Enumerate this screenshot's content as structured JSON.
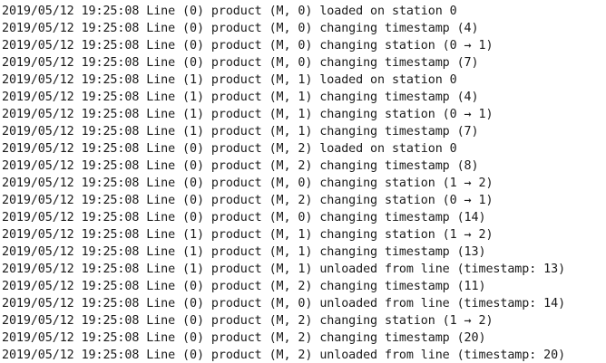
{
  "log": {
    "lines": [
      "2019/05/12 19:25:08 Line (0) product (M, 0) loaded on station 0",
      "2019/05/12 19:25:08 Line (0) product (M, 0) changing timestamp (4)",
      "2019/05/12 19:25:08 Line (0) product (M, 0) changing station (0 → 1)",
      "2019/05/12 19:25:08 Line (0) product (M, 0) changing timestamp (7)",
      "2019/05/12 19:25:08 Line (1) product (M, 1) loaded on station 0",
      "2019/05/12 19:25:08 Line (1) product (M, 1) changing timestamp (4)",
      "2019/05/12 19:25:08 Line (1) product (M, 1) changing station (0 → 1)",
      "2019/05/12 19:25:08 Line (1) product (M, 1) changing timestamp (7)",
      "2019/05/12 19:25:08 Line (0) product (M, 2) loaded on station 0",
      "2019/05/12 19:25:08 Line (0) product (M, 2) changing timestamp (8)",
      "2019/05/12 19:25:08 Line (0) product (M, 0) changing station (1 → 2)",
      "2019/05/12 19:25:08 Line (0) product (M, 2) changing station (0 → 1)",
      "2019/05/12 19:25:08 Line (0) product (M, 0) changing timestamp (14)",
      "2019/05/12 19:25:08 Line (1) product (M, 1) changing station (1 → 2)",
      "2019/05/12 19:25:08 Line (1) product (M, 1) changing timestamp (13)",
      "2019/05/12 19:25:08 Line (1) product (M, 1) unloaded from line (timestamp: 13)",
      "2019/05/12 19:25:08 Line (0) product (M, 2) changing timestamp (11)",
      "2019/05/12 19:25:08 Line (0) product (M, 0) unloaded from line (timestamp: 14)",
      "2019/05/12 19:25:08 Line (0) product (M, 2) changing station (1 → 2)",
      "2019/05/12 19:25:08 Line (0) product (M, 2) changing timestamp (20)",
      "2019/05/12 19:25:08 Line (0) product (M, 2) unloaded from line (timestamp: 20)"
    ]
  }
}
